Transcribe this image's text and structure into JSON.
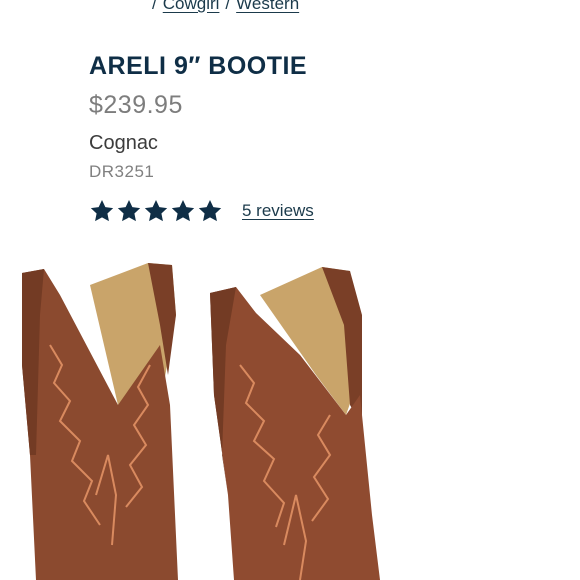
{
  "breadcrumb": {
    "items": [
      "Cowgirl",
      "Western"
    ],
    "separator": "/"
  },
  "product": {
    "name": "ARELI 9″ BOOTIE",
    "price": "$239.95",
    "color_name": "Cognac",
    "sku": "DR3251",
    "rating_stars": 5,
    "rating_max": 5,
    "reviews_link": "5 reviews"
  },
  "icons": {
    "star": "star-icon"
  },
  "colors": {
    "title": "#0f2e46",
    "price": "#7d7d7d",
    "star": "#0f2e46",
    "link": "#1b3a4b",
    "boot_leather": "#8b4a2f",
    "boot_stitching": "#d98a5f",
    "boot_lining": "#c9a46a"
  }
}
